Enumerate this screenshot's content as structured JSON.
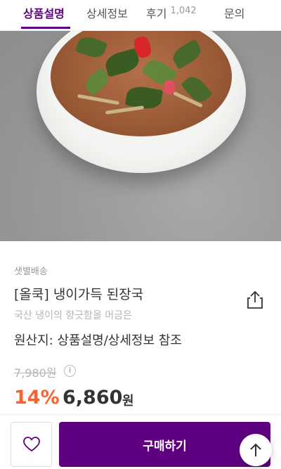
{
  "tabs": [
    {
      "label": "상품설명",
      "active": true
    },
    {
      "label": "상세정보",
      "active": false
    },
    {
      "label": "후기",
      "count": "1,042",
      "active": false
    },
    {
      "label": "문의",
      "active": false
    }
  ],
  "product": {
    "delivery": "샛별배송",
    "title": "[올쿡] 냉이가득 된장국",
    "subtitle": "국산 냉이의 향긋함을 머금은",
    "origin": "원산지: 상품설명/상세정보 참조",
    "original_price": "7,980원",
    "discount": "14%",
    "price": "6,860",
    "currency": "원"
  },
  "actions": {
    "buy_label": "구매하기"
  },
  "icons": {
    "share": "share-icon",
    "wish": "heart-icon",
    "info": "info-icon",
    "top": "arrow-up-icon"
  },
  "colors": {
    "brand": "#5f0080",
    "discount": "#fa622f"
  }
}
